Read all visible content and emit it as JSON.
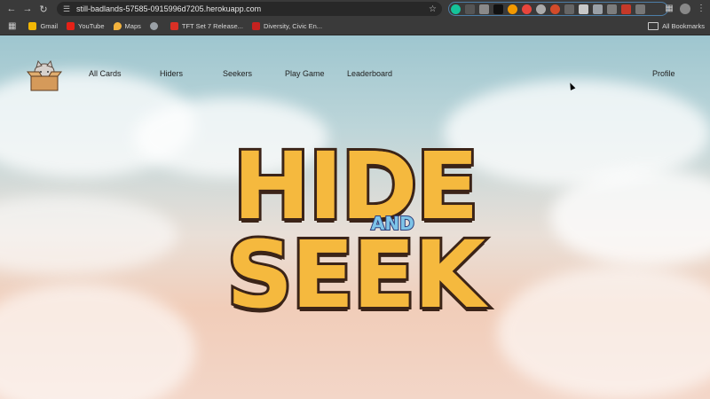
{
  "browser": {
    "url": "still-badlands-57585-0915996d7205.herokuapp.com",
    "bookmarks": [
      {
        "label": "Gmail",
        "color": "#f2b705"
      },
      {
        "label": "YouTube",
        "color": "#e62117"
      },
      {
        "label": "Maps",
        "color": "#f3b33d"
      },
      {
        "label": "",
        "color": "#9aa0a6"
      },
      {
        "label": "TFT Set 7 Release...",
        "color": "#d93025"
      },
      {
        "label": "Diversity, Civic En...",
        "color": "#c5221f"
      }
    ],
    "all_bookmarks": "All Bookmarks"
  },
  "site": {
    "nav": {
      "all_cards": "All Cards",
      "hiders": "Hiders",
      "seekers": "Seekers",
      "play_game": "Play Game",
      "leaderboard": "Leaderboard",
      "profile": "Profile"
    },
    "hero": {
      "word1": "HIDE",
      "and": "AND",
      "word2": "SEEK"
    }
  },
  "colors": {
    "title_fill": "#f5b93e",
    "title_outline": "#3b2418",
    "and_fill": "#7ec4e8"
  }
}
